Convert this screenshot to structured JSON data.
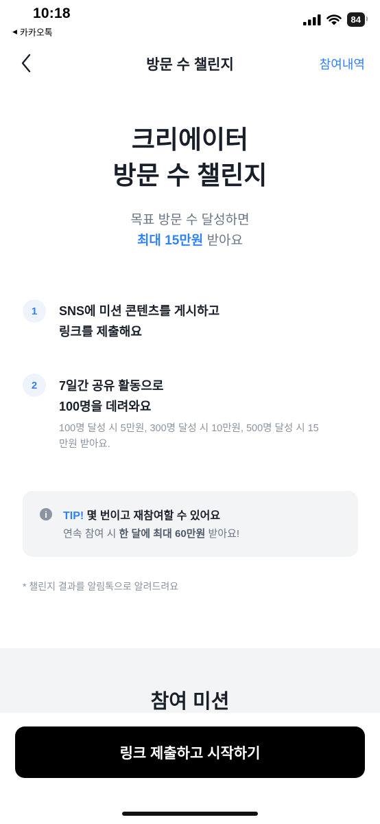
{
  "status_bar": {
    "time": "10:18",
    "back_app": "카카오톡",
    "battery": "84"
  },
  "nav": {
    "title": "방문 수 챌린지",
    "right_link": "참여내역"
  },
  "hero": {
    "title_line1": "크리에이터",
    "title_line2": "방문 수 챌린지",
    "sub_line1": "목표 방문 수 달성하면",
    "sub_highlight": "최대 15만원",
    "sub_suffix": " 받아요"
  },
  "steps": [
    {
      "num": "1",
      "line1": "SNS에 미션 콘텐츠를 게시하고",
      "line2": "링크를 제출해요"
    },
    {
      "num": "2",
      "line1": "7일간 공유 활동으로",
      "line2": "100명을 데려와요",
      "note_line1": "100명 달성 시 5만원, 300명 달성 시 10만원, 500명 달성 시 15",
      "note_line2": "만원 받아요."
    }
  ],
  "tip": {
    "label": "TIP!",
    "text": " 몇 번이고 재참여할 수 있어요",
    "line2_prefix": "연속 참여 시 ",
    "line2_bold": "한 달에 최대 60만원",
    "line2_suffix": " 받아요!"
  },
  "footnote": "* 챌린지 결과를 알림톡으로 알려드려요",
  "mission": {
    "title": "참여 미션"
  },
  "cta": {
    "label": "링크 제출하고 시작하기"
  },
  "colors": {
    "accent": "#3182f6",
    "cta_bg": "#000000",
    "tip_bg": "#f2f4f6"
  }
}
